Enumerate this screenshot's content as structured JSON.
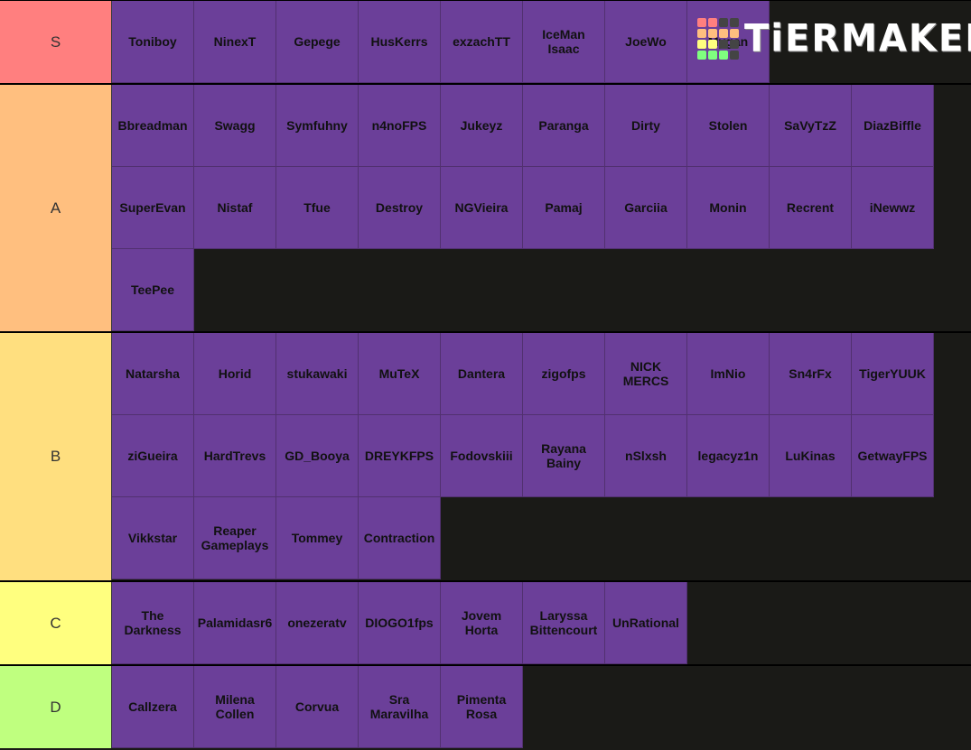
{
  "tiers": [
    {
      "label": "S",
      "color": "#ff7f7f",
      "items": [
        "Toniboy",
        "NinexT",
        "Gepege",
        "HusKerrs",
        "exzachTT",
        "IceMan\nIsaac",
        "JoeWo",
        "Mygan"
      ]
    },
    {
      "label": "A",
      "color": "#ffbf7f",
      "items": [
        "Bbreadman",
        "Swagg",
        "Symfuhny",
        "n4noFPS",
        "Jukeyz",
        "Paranga",
        "Dirty",
        "Stolen",
        "SaVyTzZ",
        "DiazBiffle",
        "SuperEvan",
        "Nistaf",
        "Tfue",
        "Destroy",
        "NGVieira",
        "Pamaj",
        "Garciia",
        "Monin",
        "Recrent",
        "iNewwz",
        "TeePee"
      ]
    },
    {
      "label": "B",
      "color": "#ffdf7f",
      "items": [
        "Natarsha",
        "Horid",
        "stukawaki",
        "MuTeX",
        "Dantera",
        "zigofps",
        "NICK\nMERCS",
        "ImNio",
        "Sn4rFx",
        "TigerYUUK",
        "ziGueira",
        "HardTrevs",
        "GD_Booya",
        "DREYKFPS",
        "Fodovskiii",
        "Rayana\nBainy",
        "nSlxsh",
        "legacyz1n",
        "LuKinas",
        "GetwayFPS",
        "Vikkstar",
        "Reaper\nGameplays",
        "Tommey",
        "Contraction"
      ]
    },
    {
      "label": "C",
      "color": "#ffff7f",
      "items": [
        "The\nDarkness",
        "Palamidasr6",
        "onezeratv",
        "DIOGO1fps",
        "Jovem\nHorta",
        "Laryssa\nBittencourt",
        "UnRational"
      ]
    },
    {
      "label": "D",
      "color": "#bfff7f",
      "items": [
        "Callzera",
        "Milena\nCollen",
        "Corvua",
        "Sra\nMaravilha",
        "Pimenta\nRosa"
      ]
    }
  ],
  "logo": {
    "text": "TiERMAKER",
    "grid_colors": [
      "#ff7f7f",
      "#ff7f7f",
      "#444444",
      "#444444",
      "#ffbf7f",
      "#ffbf7f",
      "#ffbf7f",
      "#ffbf7f",
      "#ffff7f",
      "#ffff7f",
      "#444444",
      "#444444",
      "#7fff7f",
      "#7fff7f",
      "#7fff7f",
      "#444444"
    ]
  },
  "colors": {
    "item_bg": "#6b3f99",
    "empty_bg": "#1a1a17"
  }
}
